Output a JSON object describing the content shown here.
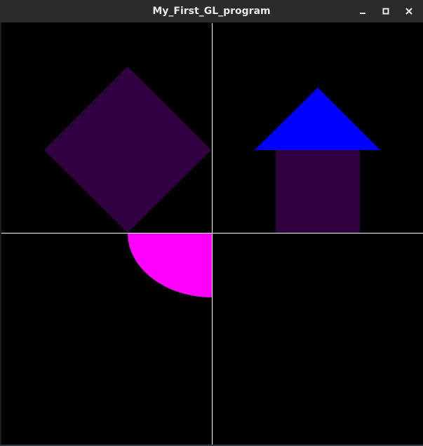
{
  "window": {
    "title": "My_First_GL_program",
    "controls": [
      "minimize",
      "maximize",
      "close"
    ]
  },
  "scene": {
    "background_color": "#000000",
    "axis_color": "#ffffff",
    "shapes": [
      {
        "kind": "diamond",
        "color": "#300040"
      },
      {
        "kind": "house-roof-triangle",
        "color": "#0000ff"
      },
      {
        "kind": "house-body-rectangle",
        "color": "#300040"
      },
      {
        "kind": "quarter-disc",
        "color": "#ff00ff"
      }
    ]
  }
}
